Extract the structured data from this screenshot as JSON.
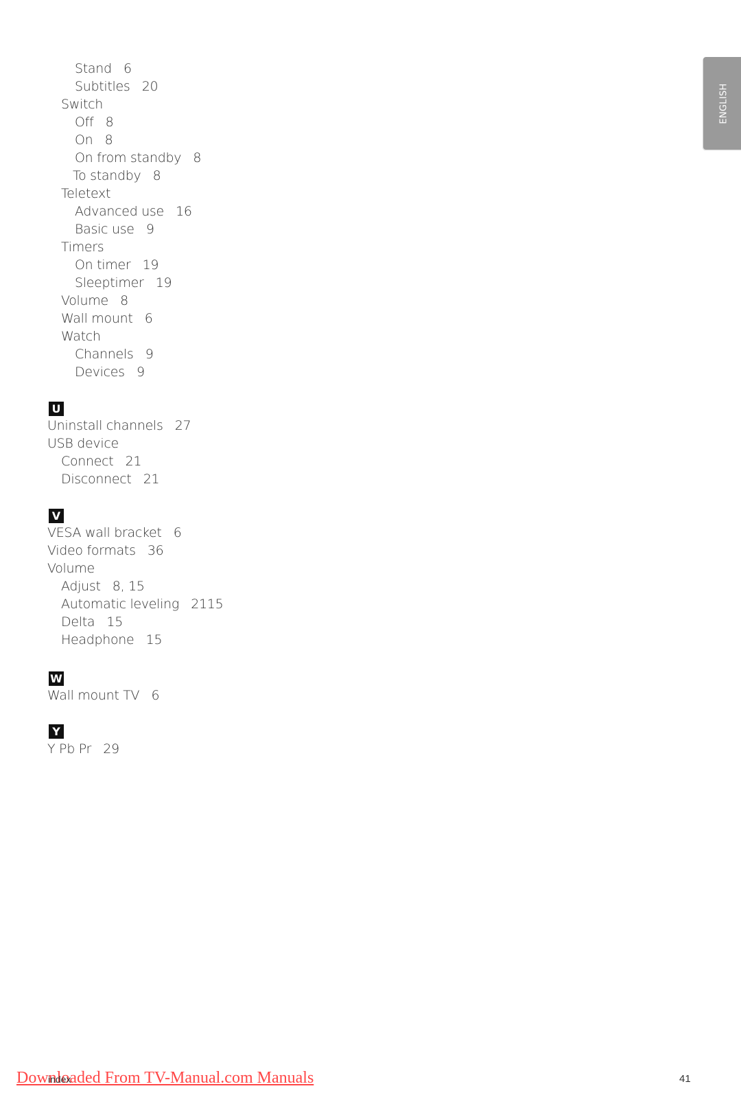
{
  "language_tab": {
    "label": "ENGLISH"
  },
  "index": {
    "continued_entries": [
      {
        "text": "Stand   6",
        "level": 2
      },
      {
        "text": "Subtitles   20",
        "level": 2
      },
      {
        "text": "Switch",
        "level": 1
      },
      {
        "text": "Off   8",
        "level": 2
      },
      {
        "text": "On   8",
        "level": 2
      },
      {
        "text": "On from standby   8",
        "level": 2
      },
      {
        "text": "To standby   8",
        "level": 2
      },
      {
        "text": "Teletext",
        "level": 1
      },
      {
        "text": "Advanced use   16",
        "level": 2
      },
      {
        "text": "Basic use   9",
        "level": 2
      },
      {
        "text": "Timers",
        "level": 1
      },
      {
        "text": "On timer   19",
        "level": 2
      },
      {
        "text": "Sleeptimer   19",
        "level": 2
      },
      {
        "text": "Volume   8",
        "level": 1
      },
      {
        "text": "Wall mount   6",
        "level": 1
      },
      {
        "text": "Watch",
        "level": 1
      },
      {
        "text": "Channels   9",
        "level": 2
      },
      {
        "text": "Devices   9",
        "level": 2
      }
    ],
    "sections": [
      {
        "letter": "U",
        "entries": [
          {
            "text": "Uninstall channels   27",
            "level": 0
          },
          {
            "text": "USB device",
            "level": 0
          },
          {
            "text": "Connect   21",
            "level": 1
          },
          {
            "text": "Disconnect   21",
            "level": 1
          }
        ]
      },
      {
        "letter": "V",
        "entries": [
          {
            "text": "VESA wall bracket   6",
            "level": 0
          },
          {
            "text": "Video formats   36",
            "level": 0
          },
          {
            "text": "Volume",
            "level": 0
          },
          {
            "text": "Adjust   8, 15",
            "level": 1
          },
          {
            "text": "Automatic leveling   2115",
            "level": 1
          },
          {
            "text": "Delta   15",
            "level": 1
          },
          {
            "text": "Headphone   15",
            "level": 1
          }
        ]
      },
      {
        "letter": "W",
        "entries": [
          {
            "text": "Wall mount TV   6",
            "level": 0
          }
        ]
      },
      {
        "letter": "Y",
        "entries": [
          {
            "text": "Y Pb Pr   29",
            "level": 0
          }
        ]
      }
    ]
  },
  "footer": {
    "section_label": "index",
    "page_number": "41",
    "watermark_link": "Downloaded From TV-Manual.com Manuals",
    "watermark_color": "#ff3333"
  }
}
